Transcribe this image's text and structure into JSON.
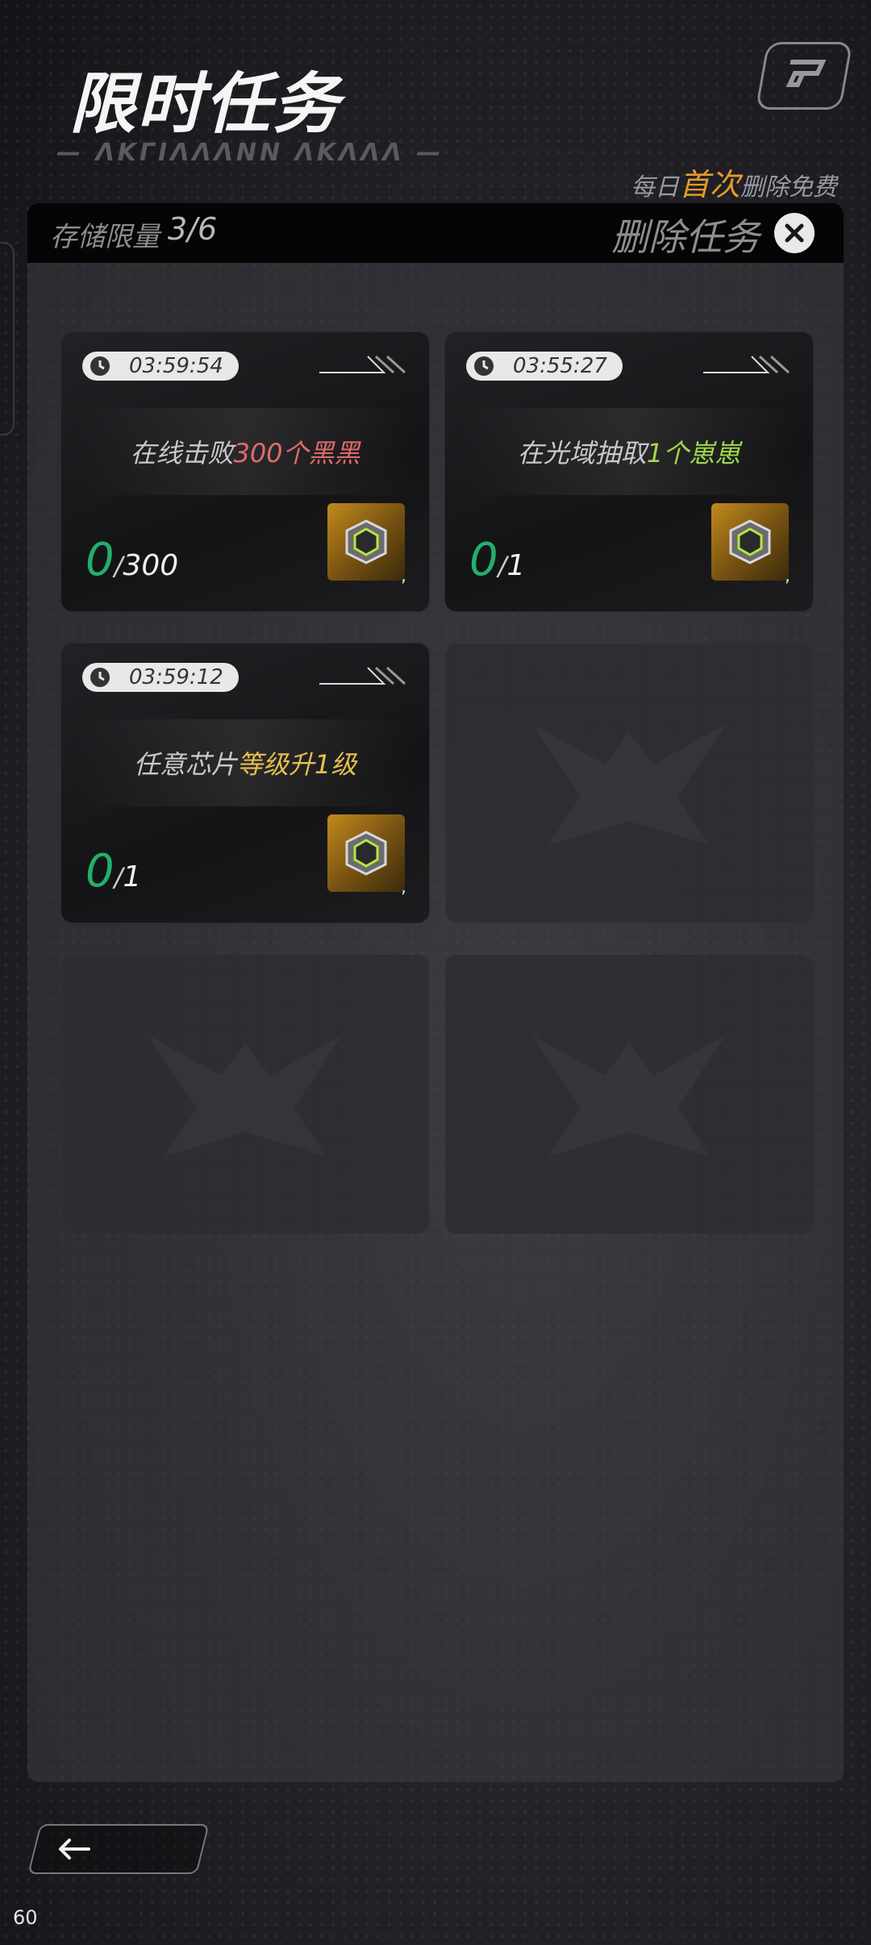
{
  "header": {
    "title": "限时任务",
    "subtitle": "— ΛΚΓΙΛΛΛΝΝ ΛΚΛΛΛ —"
  },
  "note": {
    "prefix": "每日",
    "highlight": "首次",
    "suffix": "删除免费"
  },
  "storage": {
    "label": "存储限量",
    "value": "3/6"
  },
  "delete": {
    "label": "删除任务"
  },
  "tasks": [
    {
      "time": "03:59:54",
      "text_plain": "在线击败",
      "text_highlight": "300个黑黑",
      "highlight_color": "#e06a6a",
      "progress_current": "0",
      "progress_separator": "/",
      "progress_total": "300",
      "reward_icon": "chip-box-icon",
      "reward_suffix": ","
    },
    {
      "time": "03:55:27",
      "text_plain": "在光域抽取",
      "text_highlight": "1个崽崽",
      "highlight_color": "#9ed84a",
      "progress_current": "0",
      "progress_separator": "/",
      "progress_total": "1",
      "reward_icon": "chip-box-icon",
      "reward_suffix": ","
    },
    {
      "time": "03:59:12",
      "text_plain": "任意芯片",
      "text_highlight": "等级升1级",
      "highlight_color": "#e7bf4e",
      "progress_current": "0",
      "progress_separator": "/",
      "progress_total": "1",
      "reward_icon": "chip-box-icon",
      "reward_suffix": ","
    }
  ],
  "empty_slots": 3,
  "back": {
    "icon": "arrow-left-icon"
  },
  "fps": "60",
  "colors": {
    "accent_orange": "#e79a2a",
    "progress_green": "#22b06a"
  }
}
